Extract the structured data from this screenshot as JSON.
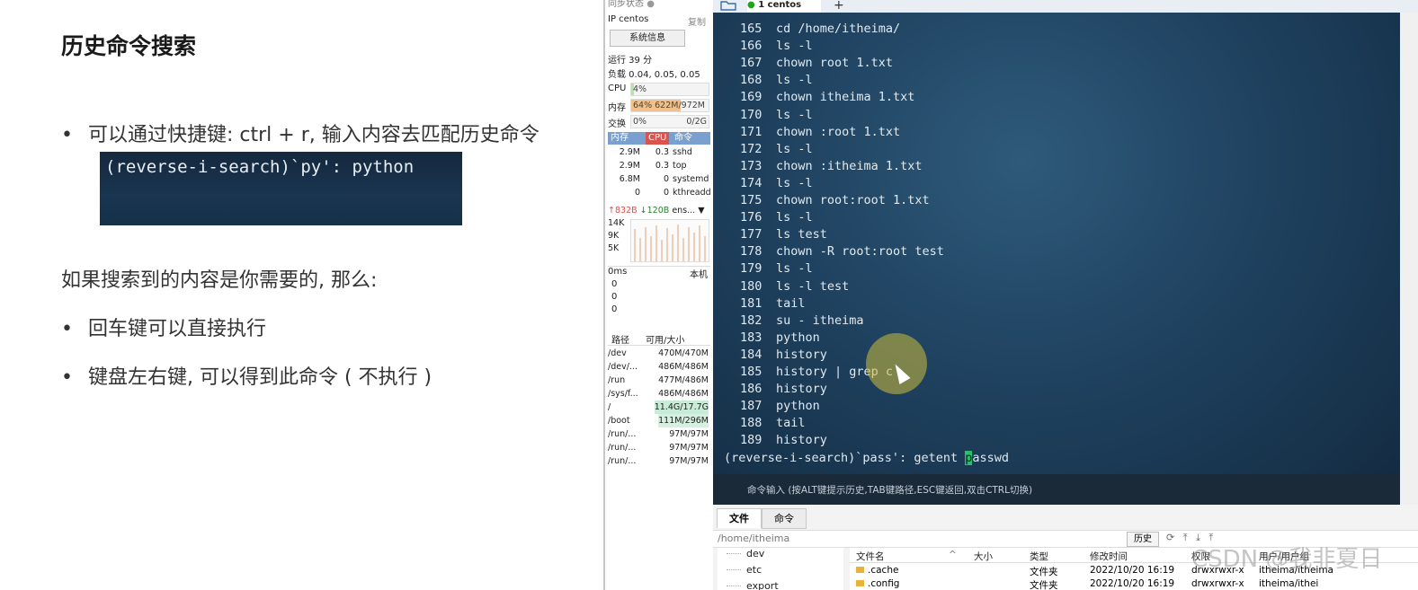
{
  "slide": {
    "title": "历史命令搜索",
    "bullet1": "可以通过快捷键: ctrl + r, 输入内容去匹配历史命令",
    "example_cmd": "(reverse-i-search)`py': python",
    "paragraph": "如果搜索到的内容是你需要的, 那么:",
    "bullet2": "回车键可以直接执行",
    "bullet3": "键盘左右键, 可以得到此命令 ( 不执行 )",
    "bullet_mark": "•"
  },
  "monitor": {
    "sync_label": "同步状态",
    "ip_label": "IP centos",
    "copy_label": "复制",
    "sysinfo_button": "系统信息",
    "uptime": "运行 39 分",
    "load": "负载 0.04, 0.05, 0.05",
    "cpu_label": "CPU",
    "cpu_value": "4%",
    "cpu_fraction": 0.04,
    "mem_label": "内存",
    "mem_value": "64% 622M/972M",
    "mem_fraction": 0.64,
    "swap_label": "交换",
    "swap_value": "0%",
    "swap_total": "0/2G",
    "proc_headers": [
      "内存",
      "CPU",
      "命令"
    ],
    "processes": [
      {
        "mem": "2.9M",
        "cpu": "0.3",
        "cmd": "sshd"
      },
      {
        "mem": "2.9M",
        "cpu": "0.3",
        "cmd": "top"
      },
      {
        "mem": "6.8M",
        "cpu": "0",
        "cmd": "systemd"
      },
      {
        "mem": "0",
        "cpu": "0",
        "cmd": "kthreadd"
      }
    ],
    "net_up": "↑832B",
    "net_down": "↓120B",
    "net_iface": "ens... ▼",
    "net_scale": [
      "14K",
      "9K",
      "5K"
    ],
    "ping_label": "0ms",
    "ping_target": "本机",
    "ping_values": [
      "0",
      "0",
      "0"
    ],
    "disk_headers": [
      "路径",
      "可用/大小"
    ],
    "disks": [
      {
        "path": "/dev",
        "size": "470M/470M"
      },
      {
        "path": "/dev/...",
        "size": "486M/486M"
      },
      {
        "path": "/run",
        "size": "477M/486M"
      },
      {
        "path": "/sys/f...",
        "size": "486M/486M"
      },
      {
        "path": "/",
        "size": "11.4G/17.7G"
      },
      {
        "path": "/boot",
        "size": "111M/296M"
      },
      {
        "path": "/run/...",
        "size": "97M/97M"
      },
      {
        "path": "/run/...",
        "size": "97M/97M"
      },
      {
        "path": "/run/...",
        "size": "97M/97M"
      }
    ]
  },
  "tabs": {
    "active_label": "1 centos",
    "add_label": "+",
    "folder_icon": "folder-icon"
  },
  "terminal": {
    "history": [
      {
        "n": "165",
        "cmd": "cd /home/itheima/"
      },
      {
        "n": "166",
        "cmd": "ls -l"
      },
      {
        "n": "167",
        "cmd": "chown root 1.txt"
      },
      {
        "n": "168",
        "cmd": "ls -l"
      },
      {
        "n": "169",
        "cmd": "chown itheima 1.txt"
      },
      {
        "n": "170",
        "cmd": "ls -l"
      },
      {
        "n": "171",
        "cmd": "chown :root 1.txt"
      },
      {
        "n": "172",
        "cmd": "ls -l"
      },
      {
        "n": "173",
        "cmd": "chown :itheima 1.txt"
      },
      {
        "n": "174",
        "cmd": "ls -l"
      },
      {
        "n": "175",
        "cmd": "chown root:root 1.txt"
      },
      {
        "n": "176",
        "cmd": "ls -l"
      },
      {
        "n": "177",
        "cmd": "ls test"
      },
      {
        "n": "178",
        "cmd": "chown -R root:root test"
      },
      {
        "n": "179",
        "cmd": "ls -l"
      },
      {
        "n": "180",
        "cmd": "ls -l test"
      },
      {
        "n": "181",
        "cmd": "tail"
      },
      {
        "n": "182",
        "cmd": "su - itheima"
      },
      {
        "n": "183",
        "cmd": "python"
      },
      {
        "n": "184",
        "cmd": "history"
      },
      {
        "n": "185",
        "cmd": "history | grep c"
      },
      {
        "n": "186",
        "cmd": "history"
      },
      {
        "n": "187",
        "cmd": "python"
      },
      {
        "n": "188",
        "cmd": "tail"
      },
      {
        "n": "189",
        "cmd": "history"
      }
    ],
    "search_prefix": "(reverse-i-search)`pass': getent ",
    "search_cursor": "p",
    "search_suffix": "asswd",
    "hint": "命令输入 (按ALT键提示历史,TAB键路径,ESC键返回,双击CTRL切换)"
  },
  "filemanager": {
    "tab_files": "文件",
    "tab_commands": "命令",
    "path": "/home/itheima",
    "history_button": "历史",
    "tool_icons": "⟳ ⤒ ⤓ ⤒",
    "tree": [
      "dev",
      "etc",
      "export"
    ],
    "headers": [
      "文件名",
      "大小",
      "类型",
      "修改时间",
      "权限",
      "用户/用户组"
    ],
    "sort_arrow": "^",
    "rows": [
      {
        "name": ".cache",
        "size": "",
        "type": "文件夹",
        "mtime": "2022/10/20 16:19",
        "perm": "drwxrwxr-x",
        "owner": "itheima/itheima"
      },
      {
        "name": ".config",
        "size": "",
        "type": "文件夹",
        "mtime": "2022/10/20 16:19",
        "perm": "drwxrwxr-x",
        "owner": "itheima/ithei"
      }
    ]
  },
  "watermark": "CSDN @我非夏日",
  "colors": {
    "accent_tab_dot": "#21a121",
    "cursor": "#2dbd6e",
    "highlight": "#cdbe3c"
  }
}
